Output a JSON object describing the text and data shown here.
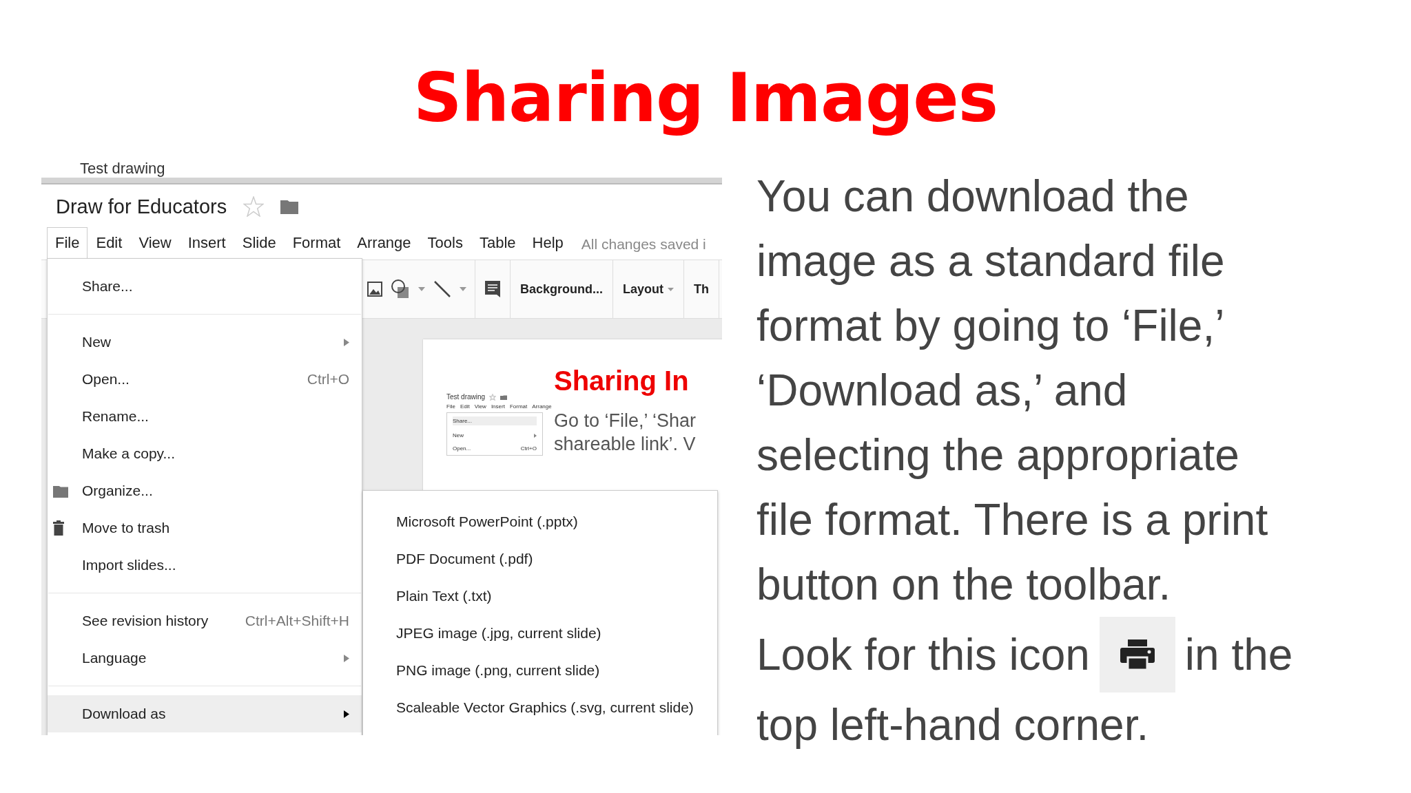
{
  "slide_title": "Sharing Images",
  "app": {
    "tab_title": "Test drawing",
    "doc_title": "Draw for Educators",
    "menu_bar": [
      {
        "label": "File",
        "selected": true
      },
      {
        "label": "Edit",
        "selected": false
      },
      {
        "label": "View",
        "selected": false
      },
      {
        "label": "Insert",
        "selected": false
      },
      {
        "label": "Slide",
        "selected": false
      },
      {
        "label": "Format",
        "selected": false
      },
      {
        "label": "Arrange",
        "selected": false
      },
      {
        "label": "Tools",
        "selected": false
      },
      {
        "label": "Table",
        "selected": false
      },
      {
        "label": "Help",
        "selected": false
      }
    ],
    "save_status": "All changes saved i",
    "toolbar_buttons": [
      {
        "label": "Background...",
        "dropdown": false
      },
      {
        "label": "Layout",
        "dropdown": true
      },
      {
        "label": "Th",
        "dropdown": false
      }
    ],
    "file_menu": [
      [
        {
          "label": "Share...",
          "kind": "plain",
          "submenu": false,
          "selected": false
        }
      ],
      [
        {
          "label": "New",
          "kind": "plain",
          "submenu": true,
          "selected": false
        },
        {
          "label": "Open...",
          "kind": "plain",
          "shortcut": "Ctrl+O",
          "submenu": false,
          "selected": false
        },
        {
          "label": "Rename...",
          "kind": "plain",
          "submenu": false,
          "selected": false
        },
        {
          "label": "Make a copy...",
          "kind": "plain",
          "submenu": false,
          "selected": false
        },
        {
          "label": "Organize...",
          "kind": "folder",
          "submenu": false,
          "selected": false
        },
        {
          "label": "Move to trash",
          "kind": "trash",
          "submenu": false,
          "selected": false
        },
        {
          "label": "Import slides...",
          "kind": "plain",
          "submenu": false,
          "selected": false
        }
      ],
      [
        {
          "label": "See revision history",
          "kind": "plain",
          "shortcut": "Ctrl+Alt+Shift+H",
          "submenu": false,
          "selected": false
        },
        {
          "label": "Language",
          "kind": "plain",
          "submenu": true,
          "selected": false
        }
      ],
      [
        {
          "label": "Download as",
          "kind": "plain",
          "submenu": true,
          "selected": true
        }
      ]
    ],
    "download_menu": [
      "Microsoft PowerPoint (.pptx)",
      "PDF Document (.pdf)",
      "Plain Text (.txt)",
      "JPEG image (.jpg, current slide)",
      "PNG image (.png, current slide)",
      "Scaleable Vector Graphics (.svg, current slide)"
    ],
    "slide_preview": {
      "title": "Sharing In",
      "lines": [
        "Go to ‘File,’ ‘Shar",
        "shareable link’. V"
      ],
      "mini_screenshot": {
        "title": "Test drawing",
        "menu": [
          "File",
          "Edit",
          "View",
          "Insert",
          "Format",
          "Arrange"
        ],
        "items": [
          {
            "label": "Share...",
            "submenu": false,
            "selected": true
          },
          {
            "label": "New",
            "submenu": true,
            "selected": false
          },
          {
            "label": "Open...",
            "shortcut": "Ctrl+O",
            "submenu": false,
            "selected": false
          }
        ]
      }
    }
  },
  "body_lines": [
    {
      "kind": "text",
      "text": "You can download the"
    },
    {
      "kind": "text",
      "text": "image as a standard file"
    },
    {
      "kind": "text",
      "text": "format by going to ‘File,’"
    },
    {
      "kind": "text",
      "text": "‘Download as,’ and"
    },
    {
      "kind": "text",
      "text": "selecting the appropriate"
    },
    {
      "kind": "text",
      "text": "file format. There is a print"
    },
    {
      "kind": "text",
      "text": "button on the toolbar."
    },
    {
      "kind": "icon-line",
      "before": "Look for this icon",
      "after": "in the"
    },
    {
      "kind": "text",
      "text": "top left-hand corner."
    }
  ]
}
